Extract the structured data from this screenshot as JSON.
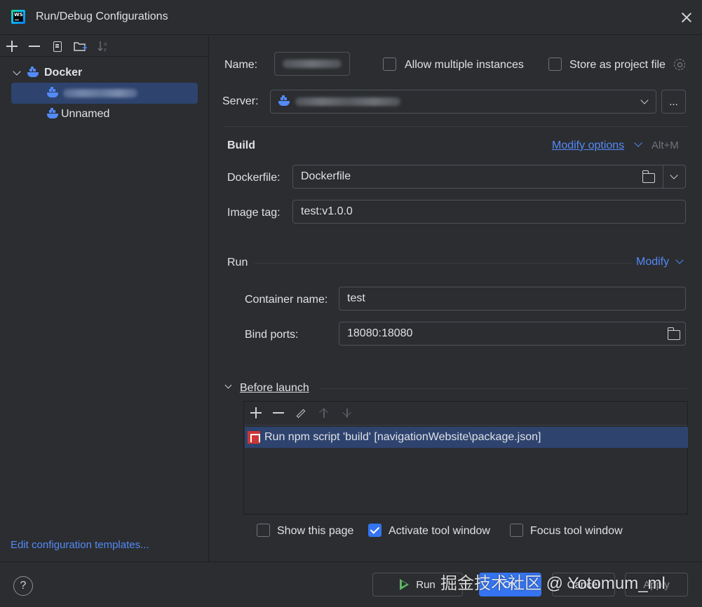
{
  "window": {
    "title": "Run/Debug Configurations"
  },
  "tree": {
    "group_label": "Docker",
    "items": [
      {
        "label": "",
        "selected": true
      },
      {
        "label": "Unnamed",
        "selected": false
      }
    ]
  },
  "left_footer": {
    "edit_templates": "Edit configuration templates..."
  },
  "form": {
    "name_label": "Name:",
    "allow_multiple": "Allow multiple instances",
    "store_project_file": "Store as project file",
    "server_label": "Server:",
    "server_more": "...",
    "build_heading": "Build",
    "modify_options": "Modify options",
    "modify_options_shortcut": "Alt+M",
    "dockerfile_label": "Dockerfile:",
    "dockerfile_value": "Dockerfile",
    "image_tag_label": "Image tag:",
    "image_tag_value": "test:v1.0.0",
    "run_heading": "Run",
    "modify_link": "Modify",
    "container_name_label": "Container name:",
    "container_name_value": "test",
    "bind_ports_label": "Bind ports:",
    "bind_ports_value": "18080:18080",
    "before_launch_label": "Before launch",
    "before_launch_items": [
      "Run npm script 'build' [navigationWebsite\\package.json]"
    ],
    "show_this_page": "Show this page",
    "activate_tool_window": "Activate tool window",
    "focus_tool_window": "Focus tool window"
  },
  "checkbox_state": {
    "allow_multiple": false,
    "store_project_file": false,
    "show_this_page": false,
    "activate_tool_window": true,
    "focus_tool_window": false
  },
  "buttons": {
    "help": "?",
    "run": "Run",
    "ok": "OK",
    "cancel": "Cancel",
    "apply": "Apply"
  },
  "watermark": "掘金技术社区 @ Yotomum_ml",
  "colors": {
    "background": "#2b2d30",
    "accent": "#3574f0",
    "link": "#548af7",
    "selection": "#2e436e",
    "docker_icon": "#548af7",
    "npm_icon": "#cb3837"
  }
}
